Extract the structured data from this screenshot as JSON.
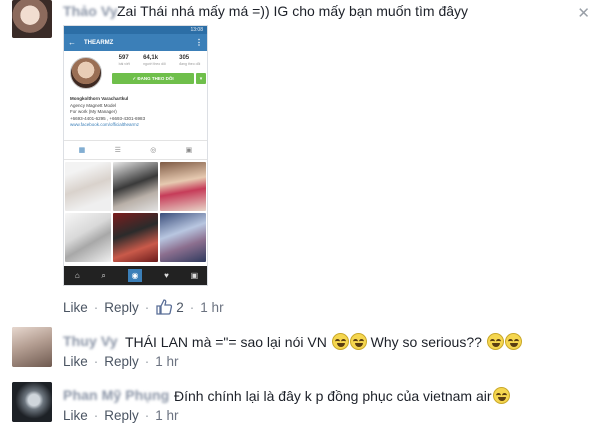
{
  "comments": [
    {
      "author": "Thảo Vy",
      "text": "Zai Thái nhá mấy má =)) IG cho mấy bạn muốn tìm đâyy",
      "like_label": "Like",
      "reply_label": "Reply",
      "like_count": "2",
      "time": "1 hr",
      "avatar_color": "#c9b3a5"
    },
    {
      "author": "Thuy Vy",
      "text": "THÁI LAN mà =\"= sao lại nói VN",
      "text_tail": "Why so serious??",
      "like_label": "Like",
      "reply_label": "Reply",
      "time": "1 hr",
      "avatar_color": "#b9a59a"
    },
    {
      "author": "Phan Mỹ Phụng",
      "text": "Đính chính lại là đây k p đồng phục của vietnam air",
      "like_label": "Like",
      "reply_label": "Reply",
      "time": "1 hr",
      "avatar_color": "#2b2f35"
    }
  ],
  "close_glyph": "✕",
  "attachment": {
    "status_time": "13:08",
    "profile_title": "THEARMZ",
    "stats": [
      {
        "value": "597",
        "label": "bài viết"
      },
      {
        "value": "64,1k",
        "label": "người theo dõi"
      },
      {
        "value": "305",
        "label": "đang theo dõi"
      }
    ],
    "follow_label": "✓ ĐANG THEO DÕI",
    "bio_name": "Mongkolthorn Varachartkul",
    "bio_lines": [
      "Agency Magnett Model",
      "For work (My Manager)",
      "+6693-4401-6295 , +6693-4301-6983"
    ],
    "bio_link": "www.facebook.com/officialthearmz"
  },
  "colors": {
    "link": "#4b5563",
    "author": "#8a94a6",
    "instagram_blue": "#3b7fb8",
    "follow_green": "#6fbf4b"
  }
}
